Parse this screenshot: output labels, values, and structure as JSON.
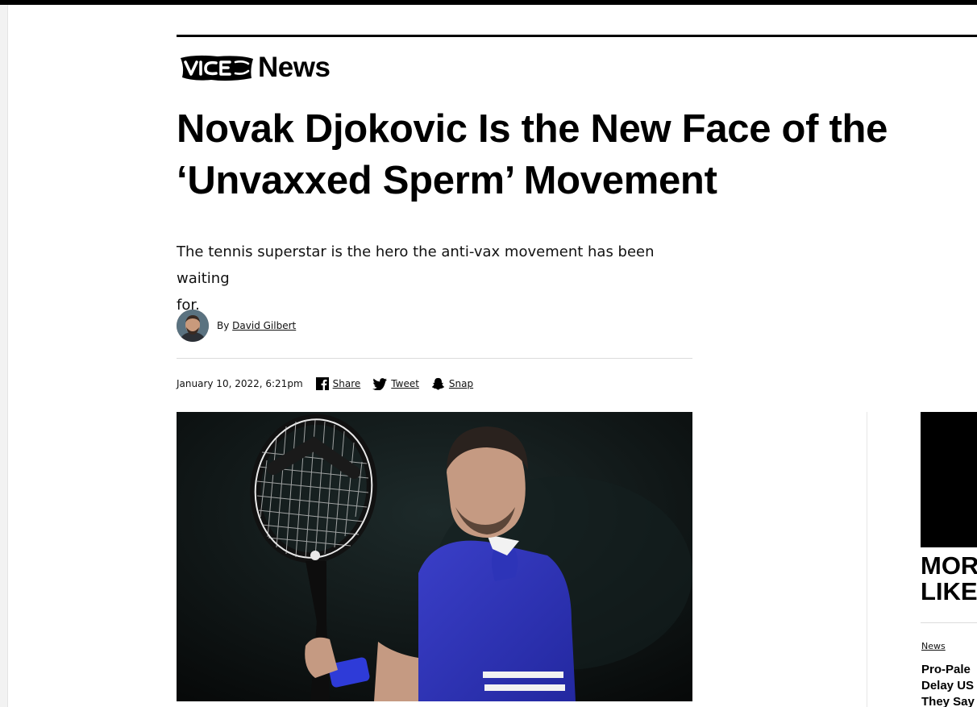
{
  "brand": {
    "logo_text": "VICE",
    "section": "News"
  },
  "article": {
    "headline_line1": "Novak Djokovic Is the New Face of the",
    "headline_line2": "‘Unvaxxed Sperm’ Movement",
    "dek_line1": "The tennis superstar is the hero the anti-vax movement has been waiting",
    "dek_line2": "for.",
    "byline_prefix": "By",
    "author": "David Gilbert",
    "date": "January 10, 2022, 6:21pm",
    "share": [
      {
        "label": "Share",
        "icon": "facebook-icon"
      },
      {
        "label": "Tweet",
        "icon": "twitter-icon"
      },
      {
        "label": "Snap",
        "icon": "snapchat-icon"
      }
    ]
  },
  "sidebar": {
    "heading_line1": "MOR",
    "heading_line2": "LIKE",
    "items": [
      {
        "category": "News",
        "title_lines": [
          "Pro-Pale",
          "Delay US",
          "They Say"
        ]
      }
    ]
  },
  "colors": {
    "text": "#000000",
    "accent_bar": "#000000",
    "divider": "#dcdcdc"
  }
}
